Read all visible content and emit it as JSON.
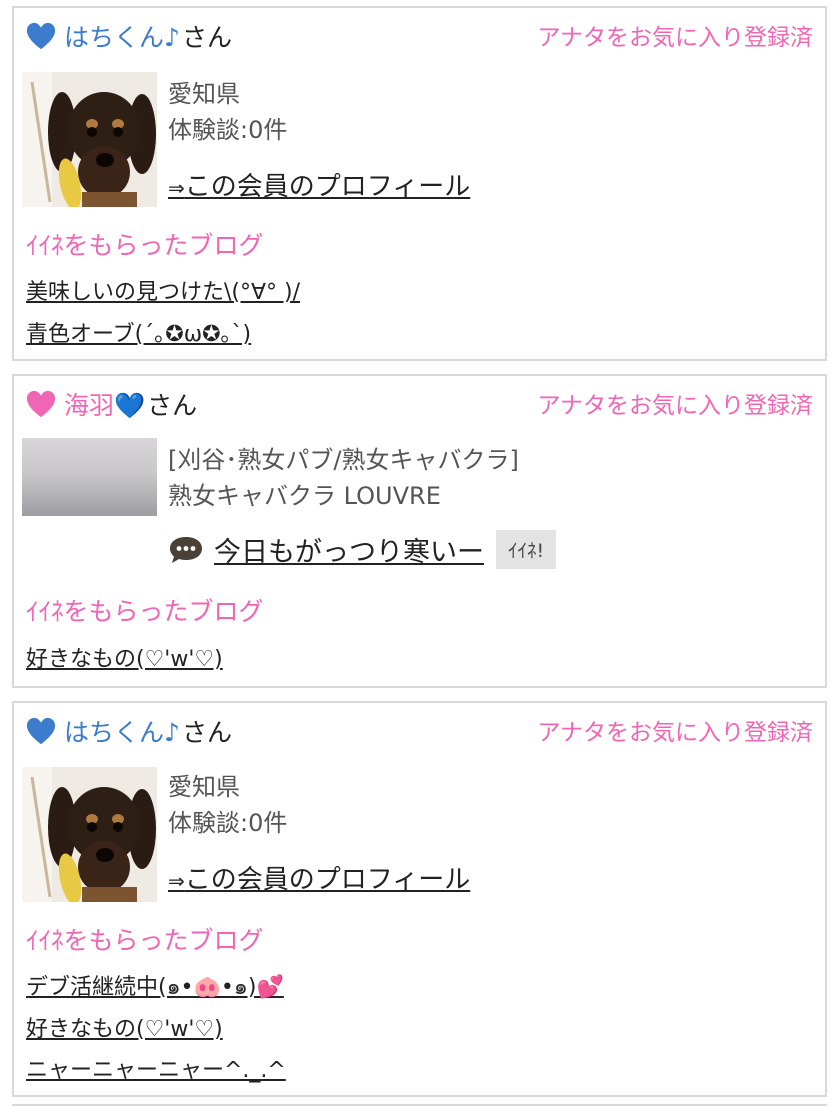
{
  "cards": [
    {
      "username": "はちくん♪",
      "honorific": "さん",
      "heart_color": "#3d7ccc",
      "favorite_label": "アナタをお気に入り登録済",
      "info_lines": [
        "愛知県",
        "体験談:0件"
      ],
      "profile_arrow": "⇒",
      "profile_link": "この会員のプロフィール",
      "section_title": "ｲｲﾈをもらったブログ",
      "blogs": [
        "美味しいの見つけた\\(°∀° )/",
        "青色オーブ(´｡✪ω✪｡`)"
      ]
    },
    {
      "username": "海羽💙",
      "honorific": "さん",
      "heart_color": "#f065b4",
      "favorite_label": "アナタをお気に入り登録済",
      "info_lines": [
        "[刈谷･熟女パブ/熟女キャバクラ]",
        "熟女キャバクラ LOUVRE"
      ],
      "message": "今日もがっつり寒いー",
      "iine_label": "ｲｲﾈ!",
      "section_title": "ｲｲﾈをもらったブログ",
      "blogs": [
        "好きなもの(♡'ᴡ'♡)"
      ]
    },
    {
      "username": "はちくん♪",
      "honorific": "さん",
      "heart_color": "#3d7ccc",
      "favorite_label": "アナタをお気に入り登録済",
      "info_lines": [
        "愛知県",
        "体験談:0件"
      ],
      "profile_arrow": "⇒",
      "profile_link": "この会員のプロフィール",
      "section_title": "ｲｲﾈをもらったブログ",
      "blogs": [
        "デブ活継続中(๑•🐽•๑)💕",
        "好きなもの(♡'ᴡ'♡)",
        "ニャーニャーニャー^._.^"
      ]
    }
  ],
  "icons": {
    "heart": "heart-icon",
    "message": "speech-bubble-icon",
    "avatar_dog": "dachshund-photo",
    "avatar_blur": "blurred-photo"
  }
}
